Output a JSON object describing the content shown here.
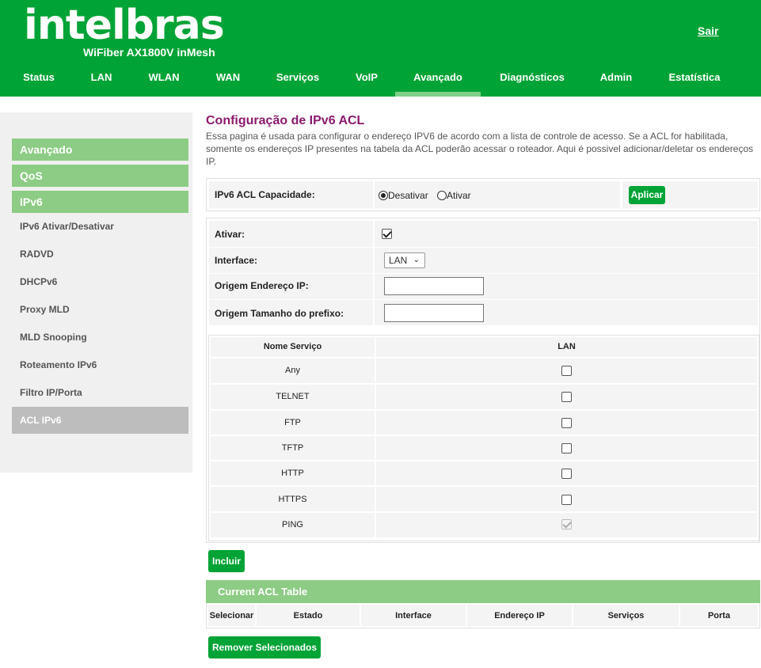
{
  "header": {
    "logo": "intelbras",
    "model": "WiFiber AX1800V inMesh",
    "logout": "Sair",
    "brand_color": "#00a335"
  },
  "nav": [
    {
      "label": "Status"
    },
    {
      "label": "LAN"
    },
    {
      "label": "WLAN"
    },
    {
      "label": "WAN"
    },
    {
      "label": "Serviços"
    },
    {
      "label": "VoIP"
    },
    {
      "label": "Avançado",
      "active": true
    },
    {
      "label": "Diagnósticos"
    },
    {
      "label": "Admin"
    },
    {
      "label": "Estatística"
    }
  ],
  "sidebar": {
    "headers": [
      "Avançado",
      "QoS",
      "IPv6"
    ],
    "items": [
      {
        "label": "IPv6 Ativar/Desativar"
      },
      {
        "label": "RADVD"
      },
      {
        "label": "DHCPv6"
      },
      {
        "label": "Proxy MLD"
      },
      {
        "label": "MLD Snooping"
      },
      {
        "label": "Roteamento IPv6"
      },
      {
        "label": "Filtro IP/Porta"
      },
      {
        "label": "ACL IPv6",
        "active": true
      }
    ]
  },
  "page": {
    "title": "Configuração de IPv6 ACL",
    "description": "Essa pagina é usada para configurar o endereço IPV6 de acordo com a lista de controle de acesso. Se a ACL for habilitada, somente os endereços IP presentes na tabela da ACL poderão acessar o roteador. Aqui é possivel adicionar/deletar os endereços IP."
  },
  "capability": {
    "label": "IPv6 ACL Capacidade:",
    "option_off": "Desativar",
    "option_on": "Ativar",
    "selected": "Desativar",
    "apply": "Aplicar"
  },
  "form": {
    "enable_label": "Ativar:",
    "enable_checked": true,
    "interface_label": "Interface:",
    "interface_value": "LAN",
    "src_ip_label": "Origem Endereço IP:",
    "src_ip_value": "",
    "prefix_label": "Origem Tamanho do prefixo:",
    "prefix_value": ""
  },
  "services": {
    "col_name": "Nome Serviço",
    "col_lan": "LAN",
    "rows": [
      {
        "name": "Any",
        "checked": false
      },
      {
        "name": "TELNET",
        "checked": false
      },
      {
        "name": "FTP",
        "checked": false
      },
      {
        "name": "TFTP",
        "checked": false
      },
      {
        "name": "HTTP",
        "checked": false
      },
      {
        "name": "HTTPS",
        "checked": false
      },
      {
        "name": "PING",
        "checked": true,
        "disabled": true
      }
    ]
  },
  "buttons": {
    "include": "Incluir",
    "remove": "Remover Selecionados"
  },
  "acl_table": {
    "title": "Current ACL Table",
    "columns": [
      "Selecionar",
      "Estado",
      "Interface",
      "Endereço IP",
      "Serviços",
      "Porta"
    ]
  }
}
